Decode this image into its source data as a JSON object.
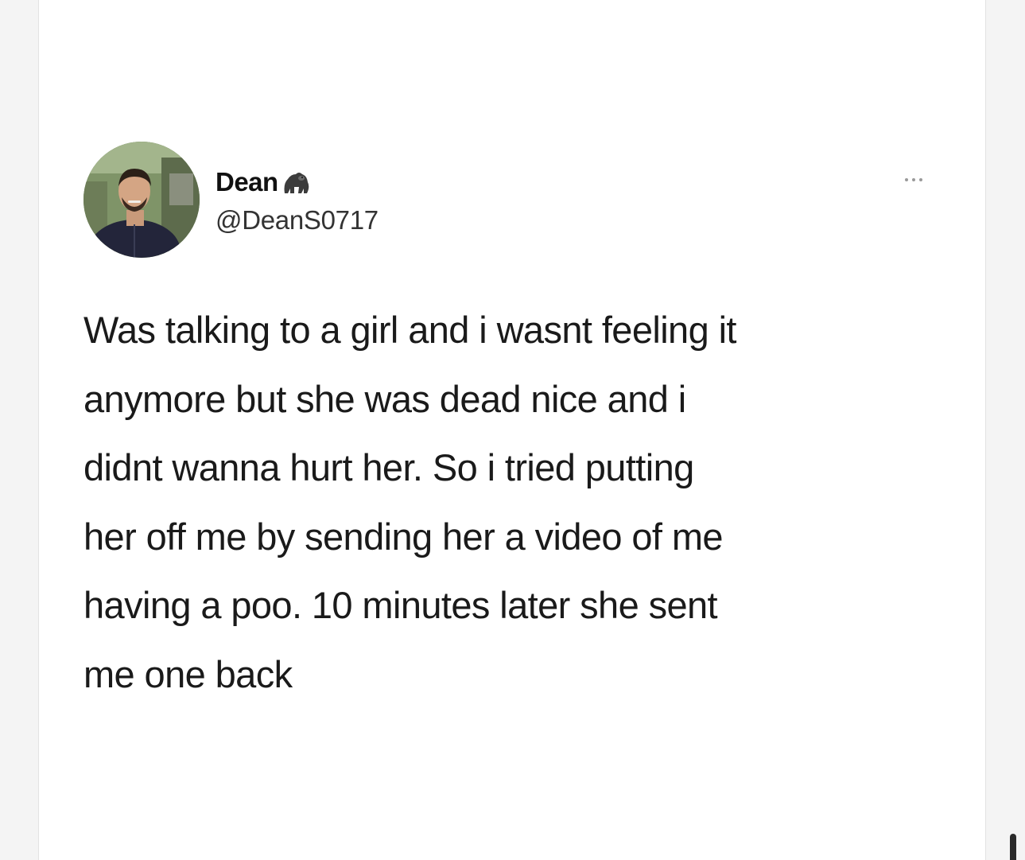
{
  "tweet": {
    "author": {
      "display_name": "Dean",
      "name_emoji": "gorilla-icon",
      "handle": "@DeanS0717"
    },
    "more_icon": "more-options-icon",
    "text": "Was talking to a girl and i wasnt feeling it\nanymore but she was dead nice and i\ndidnt wanna hurt her. So i tried putting\nher off me by sending her a video of me\nhaving a poo. 10 minutes later she sent\nme one back"
  },
  "colors": {
    "background": "#f4f4f4",
    "card": "#ffffff",
    "text": "#1a1a1a",
    "handle": "#333333",
    "more_dots": "#9a9a9a"
  }
}
